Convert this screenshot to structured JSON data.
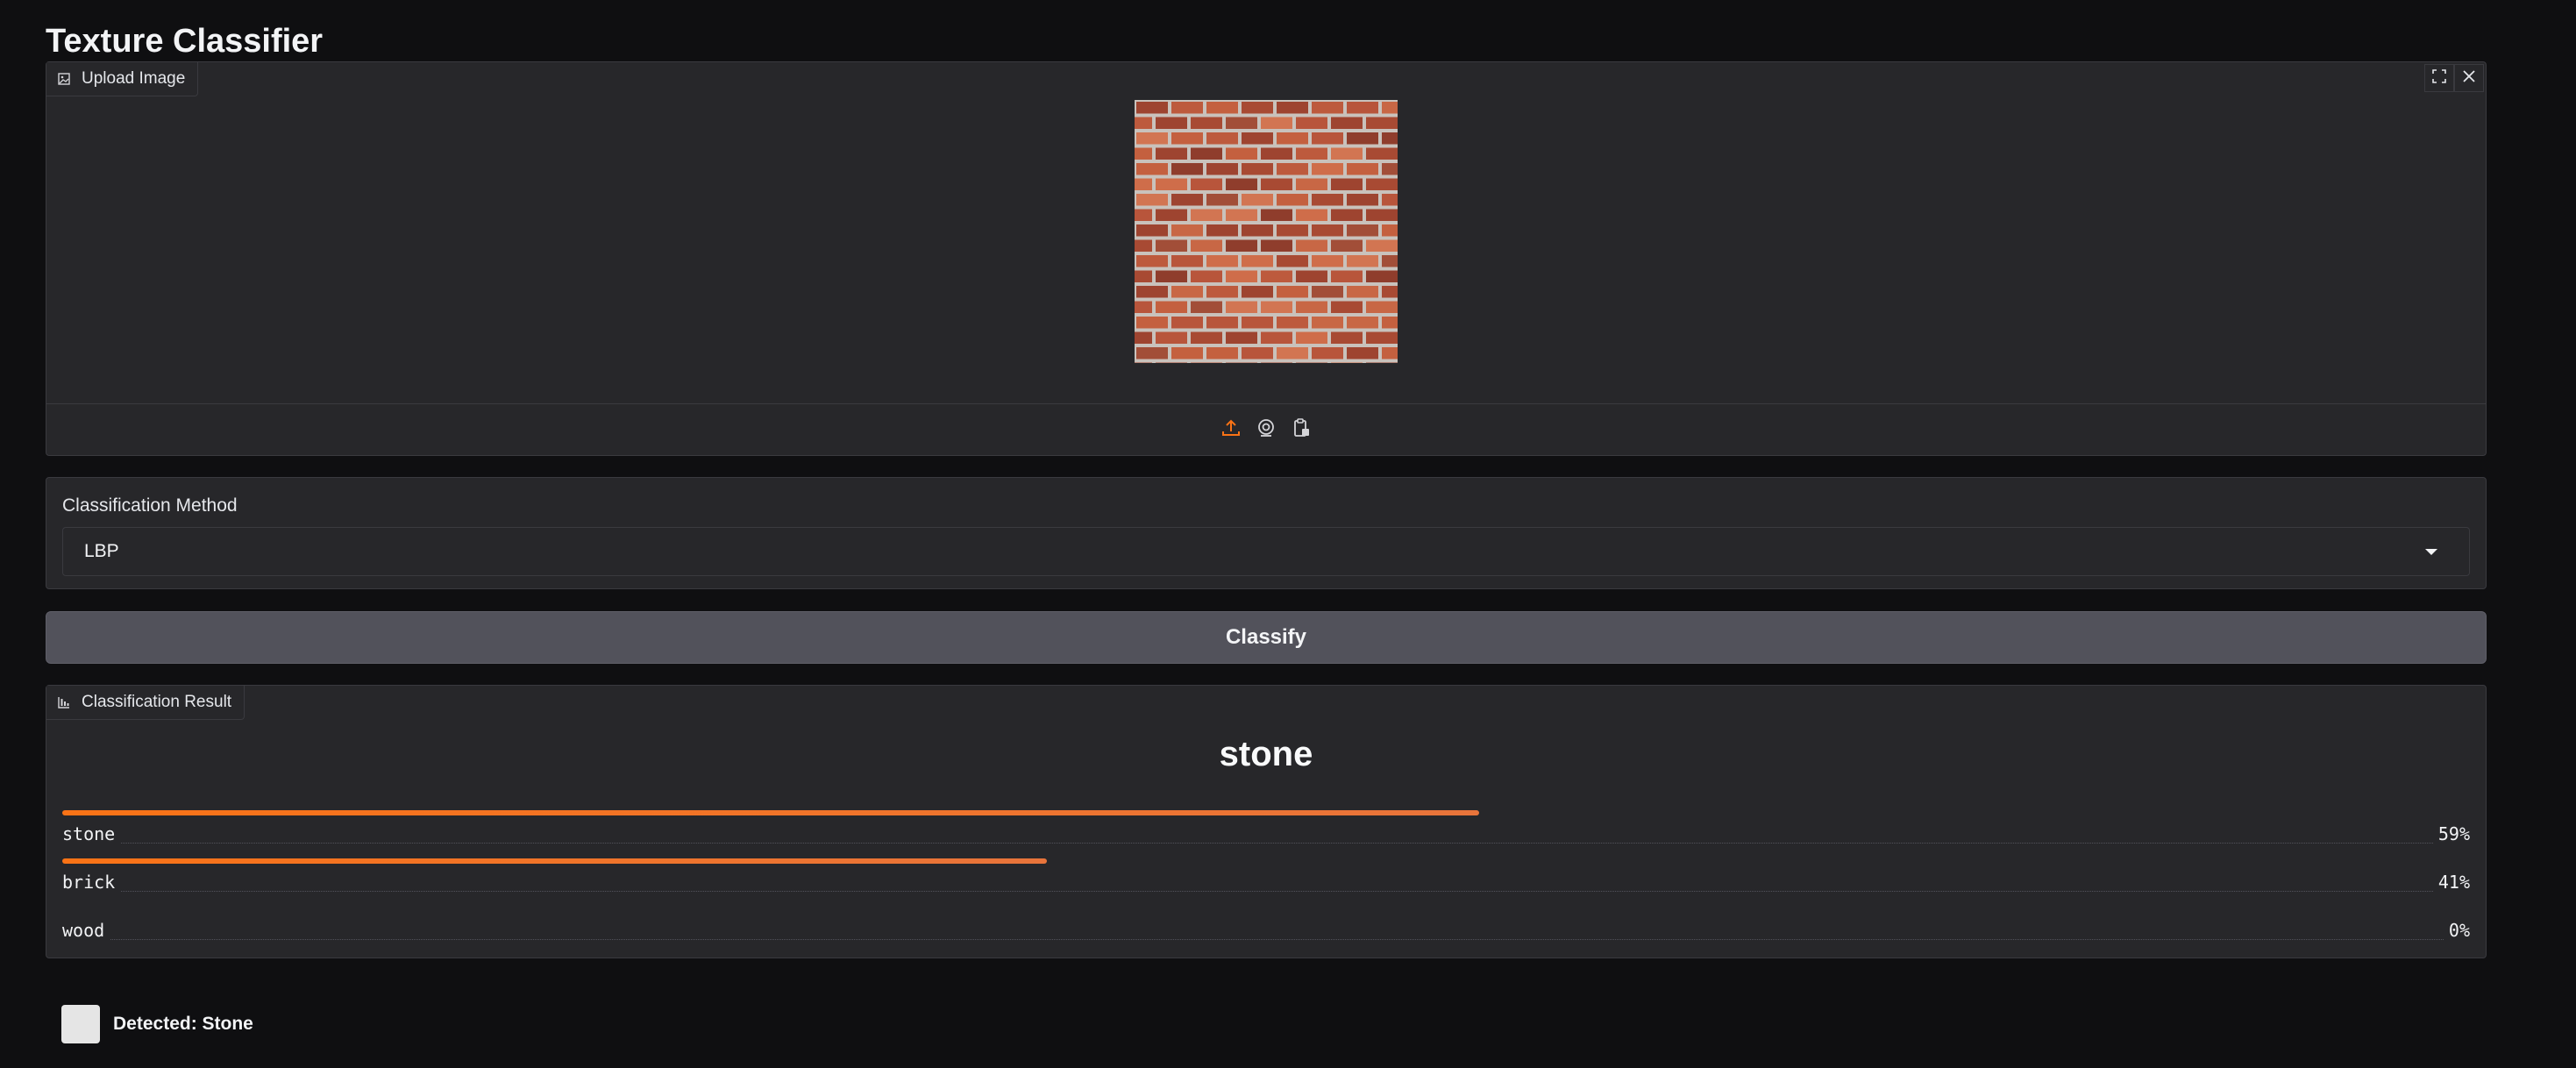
{
  "page": {
    "title": "Texture Classifier"
  },
  "upload": {
    "tag_label": "Upload Image",
    "tag_icon": "image-icon",
    "image_alt": "brick texture",
    "controls": {
      "fullscreen_icon": "fullscreen-icon",
      "close_icon": "close-icon"
    },
    "sources": [
      "upload-icon",
      "webcam-icon",
      "clipboard-icon"
    ]
  },
  "method": {
    "label": "Classification Method",
    "selected": "LBP"
  },
  "classify_button": {
    "label": "Classify"
  },
  "result": {
    "tag_label": "Classification Result",
    "tag_icon": "bar-chart-icon",
    "top_label": "stone",
    "confidences": [
      {
        "label": "stone",
        "value": 0.59,
        "display": "59%"
      },
      {
        "label": "brick",
        "value": 0.41,
        "display": "41%"
      },
      {
        "label": "wood",
        "value": 0.0,
        "display": "0%"
      }
    ]
  },
  "detected": {
    "text": "Detected: Stone",
    "swatch_color": "#e5e5e5"
  },
  "colors": {
    "accent": "#f97316",
    "background": "#0f0f11",
    "panel": "#27272a",
    "button": "#52525b"
  }
}
